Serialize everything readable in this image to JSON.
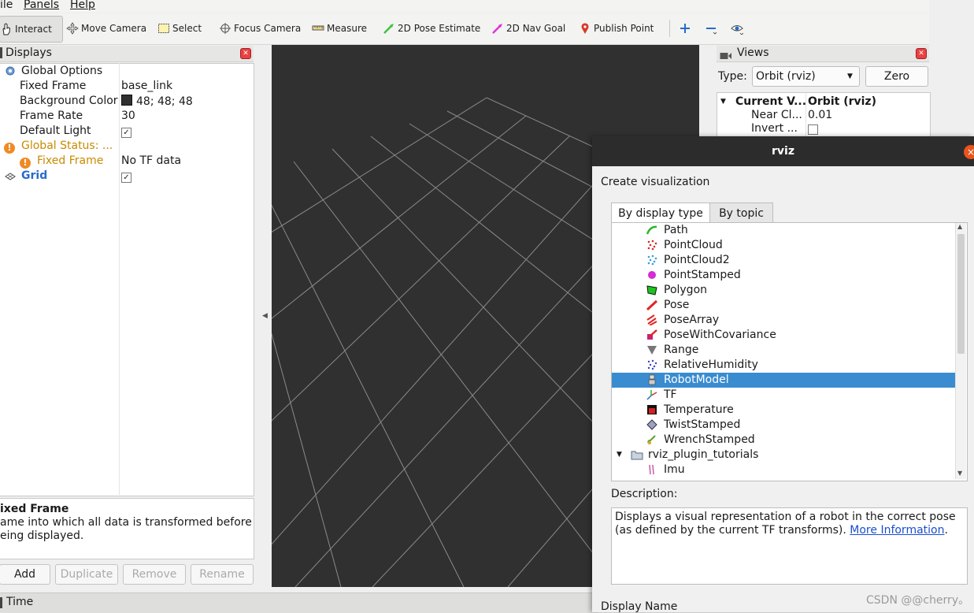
{
  "menu": {
    "file": "ile",
    "panels": "Panels",
    "help": "Help"
  },
  "toolbar": {
    "interact": "Interact",
    "move_camera": "Move Camera",
    "select": "Select",
    "focus_camera": "Focus Camera",
    "measure": "Measure",
    "pose_estimate": "2D Pose Estimate",
    "nav_goal": "2D Nav Goal",
    "publish_point": "Publish Point"
  },
  "displays": {
    "title": "Displays",
    "rows": [
      {
        "key": "Global Options",
        "value": ""
      },
      {
        "key": "Fixed Frame",
        "value": "base_link"
      },
      {
        "key": "Background Color",
        "value": "48; 48; 48"
      },
      {
        "key": "Frame Rate",
        "value": "30"
      },
      {
        "key": "Default Light",
        "value": "✓"
      },
      {
        "key": "Global Status: ...",
        "value": ""
      },
      {
        "key": "Fixed Frame",
        "value": "No TF data"
      },
      {
        "key": "Grid",
        "value": "✓"
      }
    ],
    "desc_title": "ixed Frame",
    "desc_text_1": "ame into which all data is transformed before",
    "desc_text_2": "eing displayed.",
    "buttons": {
      "add": "Add",
      "duplicate": "Duplicate",
      "remove": "Remove",
      "rename": "Rename"
    }
  },
  "time_panel": {
    "title": "Time"
  },
  "views": {
    "title": "Views",
    "type_label": "Type:",
    "type_value": "Orbit (rviz)",
    "zero": "Zero",
    "tree": [
      {
        "key": "Current V...",
        "value": "Orbit (rviz)"
      },
      {
        "key": "Near Cl...",
        "value": "0.01"
      },
      {
        "key": "Invert ...",
        "value": ""
      }
    ]
  },
  "dialog": {
    "title": "rviz",
    "close_glyph": "×",
    "heading": "Create visualization",
    "tabs": [
      "By display type",
      "By topic"
    ],
    "items": [
      {
        "label": "Path",
        "icon": "path-icon",
        "color": "#2bb52b"
      },
      {
        "label": "PointCloud",
        "icon": "pointcloud-icon",
        "color": "#d42a2a"
      },
      {
        "label": "PointCloud2",
        "icon": "pointcloud2-icon",
        "color": "#3aa0d8"
      },
      {
        "label": "PointStamped",
        "icon": "pointstamped-icon",
        "color": "#d62bd6"
      },
      {
        "label": "Polygon",
        "icon": "polygon-icon",
        "color": "#1dc41d"
      },
      {
        "label": "Pose",
        "icon": "pose-icon",
        "color": "#e02424"
      },
      {
        "label": "PoseArray",
        "icon": "posearray-icon",
        "color": "#e02424"
      },
      {
        "label": "PoseWithCovariance",
        "icon": "posewithcovariance-icon",
        "color": "#c9207a"
      },
      {
        "label": "Range",
        "icon": "range-icon",
        "color": "#777777"
      },
      {
        "label": "RelativeHumidity",
        "icon": "relativehumidity-icon",
        "color": "#3b3bd0"
      },
      {
        "label": "RobotModel",
        "icon": "robotmodel-icon",
        "color": "#cccccc"
      },
      {
        "label": "TF",
        "icon": "tf-icon",
        "color": "#d03030"
      },
      {
        "label": "Temperature",
        "icon": "temperature-icon",
        "color": "#d42020"
      },
      {
        "label": "TwistStamped",
        "icon": "twiststamped-icon",
        "color": "#7a80b0"
      },
      {
        "label": "WrenchStamped",
        "icon": "wrenchstamped-icon",
        "color": "#5aa02c"
      },
      {
        "label": "rviz_plugin_tutorials",
        "icon": "folder-icon",
        "color": "#9aa7b8"
      },
      {
        "label": "Imu",
        "icon": "imu-icon",
        "color": "#c45aa6"
      }
    ],
    "selected_index": 10,
    "description_label": "Description:",
    "description_text": "Displays a visual representation of a robot in the correct pose (as defined by the current TF transforms).",
    "more_info": "More Information",
    "display_name_label": "Display Name"
  },
  "watermark": "CSDN @@cherry。",
  "colors": {
    "view_bg": "#303030",
    "selection": "#3a8cd0",
    "grid_line": "#8a8a8a",
    "dialog_header": "#2c2c2c"
  }
}
